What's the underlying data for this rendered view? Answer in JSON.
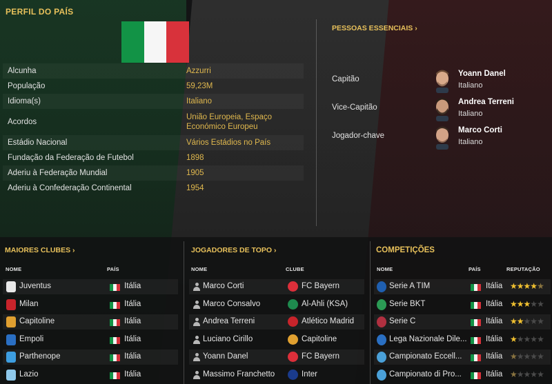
{
  "profile": {
    "title": "PERFIL DO PAÍS",
    "rows": [
      {
        "label": "Alcunha",
        "value": "Azzurri"
      },
      {
        "label": "População",
        "value": "59,23M"
      },
      {
        "label": "Idioma(s)",
        "value": "Italiano"
      },
      {
        "label": "Acordos",
        "value": "União Europeia, Espaço Económico Europeu"
      },
      {
        "label": "Estádio Nacional",
        "value": "Vários Estádios no País"
      },
      {
        "label": "Fundação da Federação de Futebol",
        "value": "1898"
      },
      {
        "label": "Aderiu à Federação Mundial",
        "value": "1905"
      },
      {
        "label": "Aderiu à Confederação Continental",
        "value": "1954"
      }
    ]
  },
  "key_people": {
    "title": "PESSOAS ESSENCIAIS ›",
    "people": [
      {
        "role": "Capitão",
        "name": "Yoann Danel",
        "nationality": "Italiano"
      },
      {
        "role": "Vice-Capitão",
        "name": "Andrea Terreni",
        "nationality": "Italiano"
      },
      {
        "role": "Jogador-chave",
        "name": "Marco Corti",
        "nationality": "Italiano"
      }
    ]
  },
  "clubs": {
    "title": "MAIORES CLUBES ›",
    "col_name": "NOME",
    "col_country": "PAÍS",
    "rows": [
      {
        "name": "Juventus",
        "country": "Itália",
        "badge_color": "#e8e8e8"
      },
      {
        "name": "Milan",
        "country": "Itália",
        "badge_color": "#c8242b"
      },
      {
        "name": "Capitoline",
        "country": "Itália",
        "badge_color": "#e0a030"
      },
      {
        "name": "Empoli",
        "country": "Itália",
        "badge_color": "#2a6fc2"
      },
      {
        "name": "Parthenope",
        "country": "Itália",
        "badge_color": "#3d9ee0"
      },
      {
        "name": "Lazio",
        "country": "Itália",
        "badge_color": "#8ec8ea"
      }
    ]
  },
  "players": {
    "title": "JOGADORES DE TOPO ›",
    "col_name": "NOME",
    "col_club": "CLUBE",
    "rows": [
      {
        "name": "Marco Corti",
        "club": "FC Bayern",
        "badge_color": "#dc2f3a"
      },
      {
        "name": "Marco Consalvo",
        "club": "Al-Ahli (KSA)",
        "badge_color": "#1e8a4e"
      },
      {
        "name": "Andrea Terreni",
        "club": "Atlético Madrid",
        "badge_color": "#c8242b"
      },
      {
        "name": "Luciano Cirillo",
        "club": "Capitoline",
        "badge_color": "#e0a030"
      },
      {
        "name": "Yoann Danel",
        "club": "FC Bayern",
        "badge_color": "#dc2f3a"
      },
      {
        "name": "Massimo Franchetto",
        "club": "Inter",
        "badge_color": "#1a3b8c"
      }
    ]
  },
  "competitions": {
    "title": "COMPETIÇÕES",
    "col_name": "NOME",
    "col_country": "PAÍS",
    "col_reputation": "REPUTAÇÃO",
    "rows": [
      {
        "name": "Serie A TIM",
        "country": "Itália",
        "reputation": 4.5,
        "badge_color": "#1f5fb0"
      },
      {
        "name": "Serie BKT",
        "country": "Itália",
        "reputation": 3,
        "badge_color": "#2b9a54"
      },
      {
        "name": "Serie C",
        "country": "Itália",
        "reputation": 2,
        "badge_color": "#b03040"
      },
      {
        "name": "Lega Nazionale Dile...",
        "country": "Itália",
        "reputation": 1,
        "badge_color": "#2a6fc2"
      },
      {
        "name": "Campionato Eccell...",
        "country": "Itália",
        "reputation": 0.5,
        "badge_color": "#4aa0d8"
      },
      {
        "name": "Campionato di Pro...",
        "country": "Itália",
        "reputation": 0.5,
        "badge_color": "#4aa0d8"
      }
    ]
  },
  "colors": {
    "accent": "#e8c15b",
    "flag_green": "#129346",
    "flag_white": "#f6f6f6",
    "flag_red": "#d8323b"
  }
}
